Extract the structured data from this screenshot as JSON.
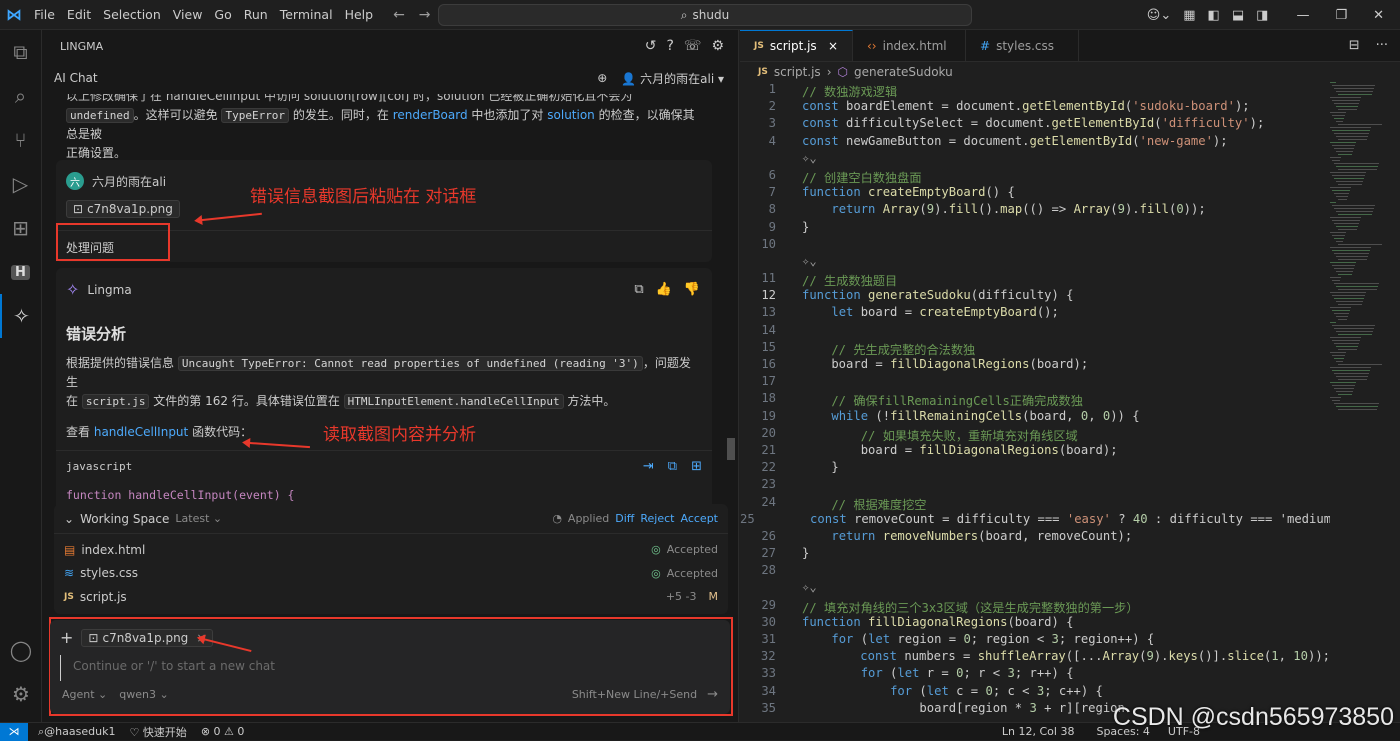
{
  "titlebar": {
    "menus": [
      "File",
      "Edit",
      "Selection",
      "View",
      "Go",
      "Run",
      "Terminal",
      "Help"
    ],
    "search": "shudu"
  },
  "sidebar": {
    "title": "LINGMA",
    "chat_title": "AI Chat",
    "user": "六月的雨在ali"
  },
  "chat": {
    "prev_line1": "以上修改确保了在 handleCellInput 中访问 solution[row][col] 时，solution 已经被正确初始化且不会为",
    "prev_line2_code": "undefined",
    "prev_line2": "。这样可以避免",
    "prev_line2_code2": "TypeError",
    "prev_line2_b": "的发生。同时，在",
    "prev_line2_link": "renderBoard",
    "prev_line2_c": "中也添加了对",
    "prev_line2_link2": "solution",
    "prev_line2_d": "的检查，以确保其总是被",
    "prev_line3": "正确设置。",
    "user_avatar": "六",
    "user_name": "六月的雨在ali",
    "attachment": "c7n8va1p.png",
    "user_msg": "处理问题",
    "bot_name": "Lingma",
    "heading": "错误分析",
    "p1_a": "根据提供的错误信息",
    "p1_code": "Uncaught TypeError: Cannot read properties of undefined (reading '3')",
    "p1_b": "，问题发生",
    "p1_c": "在",
    "p1_code2": "script.js",
    "p1_d": "文件的第 162 行。具体错误位置在",
    "p1_code3": "HTMLInputElement.handleCellInput",
    "p1_e": "方法中。",
    "p2_a": "查看",
    "p2_link": "handleCellInput",
    "p2_b": "函数代码：",
    "code_lang": "javascript",
    "code_line": "function handleCellInput(event) {"
  },
  "annotations": {
    "a1": "错误信息截图后粘贴在 对话框",
    "a2": "读取截图内容并分析"
  },
  "workspace": {
    "title": "Working Space",
    "latest": "Latest",
    "applied": "Applied",
    "diff": "Diff",
    "reject": "Reject",
    "accept": "Accept",
    "files": [
      {
        "name": "index.html",
        "status": "Accepted"
      },
      {
        "name": "styles.css",
        "status": "Accepted"
      },
      {
        "name": "script.js",
        "status": "+5 -3",
        "flag": "M"
      }
    ]
  },
  "input": {
    "attachment": "c7n8va1p.png",
    "placeholder": "Continue or '/' to start a new chat",
    "agent": "Agent",
    "model": "qwen3",
    "hint": "Shift+New Line/+Send"
  },
  "editor": {
    "tabs": [
      "script.js",
      "index.html",
      "styles.css"
    ],
    "crumb_file": "script.js",
    "crumb_fn": "generateSudoku",
    "lines": [
      {
        "n": "1",
        "t": "// 数独游戏逻辑"
      },
      {
        "n": "2",
        "t": "const boardElement = document.getElementById('sudoku-board');"
      },
      {
        "n": "3",
        "t": "const difficultySelect = document.getElementById('difficulty');"
      },
      {
        "n": "4",
        "t": "const newGameButton = document.getElementById('new-game');"
      },
      {
        "n": "",
        "t": "✧⌄"
      },
      {
        "n": "6",
        "t": "// 创建空白数独盘面"
      },
      {
        "n": "7",
        "t": "function createEmptyBoard() {"
      },
      {
        "n": "8",
        "t": "    return Array(9).fill().map(() => Array(9).fill(0));"
      },
      {
        "n": "9",
        "t": "}"
      },
      {
        "n": "10",
        "t": ""
      },
      {
        "n": "",
        "t": "✧⌄"
      },
      {
        "n": "11",
        "t": "// 生成数独题目"
      },
      {
        "n": "12",
        "t": "function generateSudoku(difficulty) {"
      },
      {
        "n": "13",
        "t": "    let board = createEmptyBoard();"
      },
      {
        "n": "14",
        "t": ""
      },
      {
        "n": "15",
        "t": "    // 先生成完整的合法数独"
      },
      {
        "n": "16",
        "t": "    board = fillDiagonalRegions(board);"
      },
      {
        "n": "17",
        "t": ""
      },
      {
        "n": "18",
        "t": "    // 确保fillRemainingCells正确完成数独"
      },
      {
        "n": "19",
        "t": "    while (!fillRemainingCells(board, 0, 0)) {"
      },
      {
        "n": "20",
        "t": "        // 如果填充失败，重新填充对角线区域"
      },
      {
        "n": "21",
        "t": "        board = fillDiagonalRegions(board);"
      },
      {
        "n": "22",
        "t": "    }"
      },
      {
        "n": "23",
        "t": ""
      },
      {
        "n": "24",
        "t": "    // 根据难度挖空"
      },
      {
        "n": "25",
        "t": "    const removeCount = difficulty === 'easy' ? 40 : difficulty === 'medium"
      },
      {
        "n": "26",
        "t": "    return removeNumbers(board, removeCount);"
      },
      {
        "n": "27",
        "t": "}"
      },
      {
        "n": "28",
        "t": ""
      },
      {
        "n": "",
        "t": "✧⌄"
      },
      {
        "n": "29",
        "t": "// 填充对角线的三个3x3区域（这是生成完整数独的第一步）"
      },
      {
        "n": "30",
        "t": "function fillDiagonalRegions(board) {"
      },
      {
        "n": "31",
        "t": "    for (let region = 0; region < 3; region++) {"
      },
      {
        "n": "32",
        "t": "        const numbers = shuffleArray([...Array(9).keys()].slice(1, 10));"
      },
      {
        "n": "33",
        "t": "        for (let r = 0; r < 3; r++) {"
      },
      {
        "n": "34",
        "t": "            for (let c = 0; c < 3; c++) {"
      },
      {
        "n": "35",
        "t": "                board[region * 3 + r][region"
      }
    ],
    "current_line": "12"
  },
  "statusbar": {
    "user": "@haaseduk1",
    "start": "快速开始",
    "errors": "0",
    "warnings": "0",
    "pos": "Ln 12, Col 38",
    "spaces": "Spaces: 4",
    "enc": "UTF-8"
  },
  "watermark": "CSDN @csdn565973850"
}
